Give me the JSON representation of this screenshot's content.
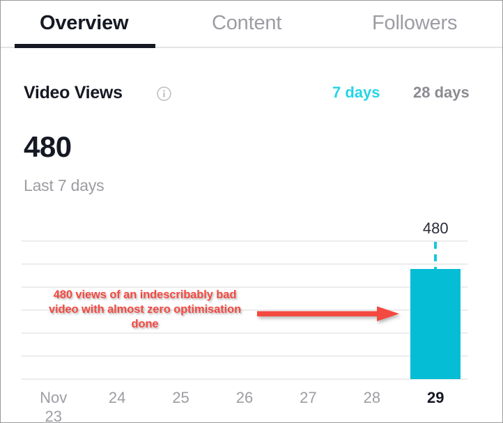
{
  "tabs": [
    {
      "label": "Overview",
      "active": true
    },
    {
      "label": "Content",
      "active": false
    },
    {
      "label": "Followers",
      "active": false
    }
  ],
  "panel": {
    "title": "Video Views",
    "info_icon": "info-circle-icon",
    "ranges": [
      {
        "label": "7 days",
        "selected": true
      },
      {
        "label": "28 days",
        "selected": false
      }
    ],
    "metric_value": "480",
    "metric_caption": "Last 7 days"
  },
  "annotation": {
    "text": "480 views of an indescribably bad video with almost zero optimisation done",
    "arrow_icon": "right-arrow-icon",
    "color": "#f44a42"
  },
  "colors": {
    "bar": "#05bdd5",
    "accent": "#25d4e8",
    "text_primary": "#161823",
    "text_muted": "#9c9ca3",
    "gridline": "#ececee"
  },
  "chart_data": {
    "type": "bar",
    "title": "Video Views",
    "xlabel": "",
    "ylabel": "",
    "categories": [
      "Nov\n23",
      "24",
      "25",
      "26",
      "27",
      "28",
      "29"
    ],
    "values": [
      0,
      0,
      0,
      0,
      0,
      0,
      480
    ],
    "data_labels": [
      "",
      "",
      "",
      "",
      "",
      "",
      "480"
    ],
    "highlighted_category": "29",
    "ylim": [
      0,
      600
    ],
    "gridlines": [
      600,
      500,
      400,
      300,
      200,
      100,
      0
    ],
    "grid": true,
    "legend": false
  }
}
